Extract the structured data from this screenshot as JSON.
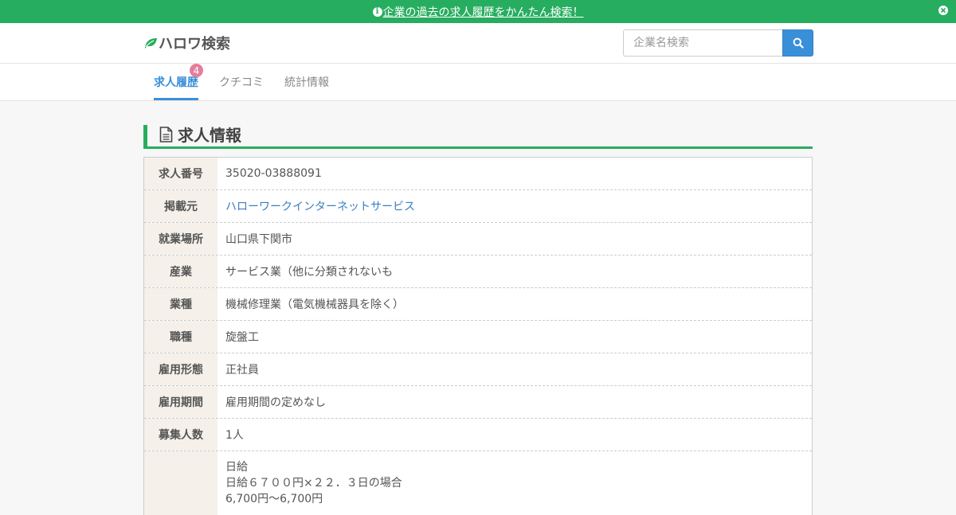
{
  "banner": {
    "link_text": "企業の過去の求人履歴をかんたん検索！",
    "info_icon": "info-circle-icon",
    "close_icon": "close-circle-icon",
    "color": "#27ad60"
  },
  "header": {
    "logo_text": "ハロワ検索",
    "logo_icon": "leaf-icon",
    "search": {
      "placeholder": "企業名検索",
      "button_icon": "search-icon"
    }
  },
  "tabs": [
    {
      "label": "求人履歴",
      "badge": "4",
      "active": true
    },
    {
      "label": "クチコミ",
      "active": false
    },
    {
      "label": "統計情報",
      "active": false
    }
  ],
  "section": {
    "title": "求人情報",
    "icon": "document-icon"
  },
  "job_info": {
    "rows": [
      {
        "label": "求人番号",
        "value": "35020-03888091"
      },
      {
        "label": "掲載元",
        "value": "ハローワークインターネットサービス",
        "link": true
      },
      {
        "label": "就業場所",
        "value": "山口県下関市"
      },
      {
        "label": "産業",
        "value": "サービス業（他に分類されないも"
      },
      {
        "label": "業種",
        "value": "機械修理業（電気機械器具を除く）"
      },
      {
        "label": "職種",
        "value": "旋盤工"
      },
      {
        "label": "雇用形態",
        "value": "正社員"
      },
      {
        "label": "雇用期間",
        "value": "雇用期間の定めなし"
      },
      {
        "label": "募集人数",
        "value": "1人"
      }
    ],
    "wage_lines": [
      "日給",
      "日給６７００円×２２．３日の場合",
      "6,700円～6,700円"
    ]
  },
  "colors": {
    "accent": "#3a8fd9",
    "brand_green": "#27ad60",
    "badge": "#e57e9b"
  }
}
